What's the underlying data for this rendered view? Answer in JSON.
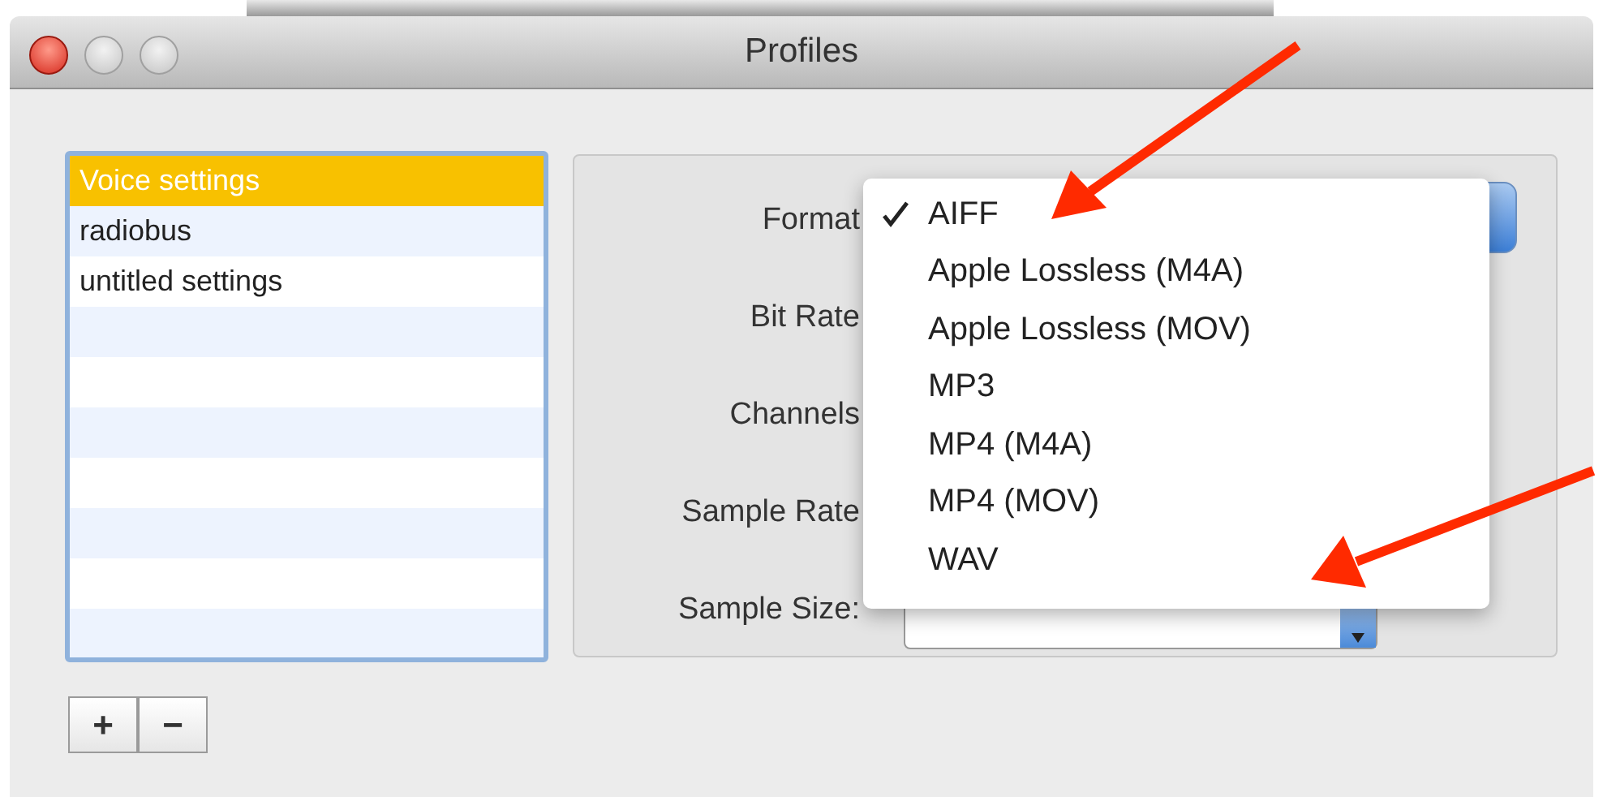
{
  "window": {
    "title": "Profiles"
  },
  "profiles": [
    {
      "name": "Voice settings",
      "selected": true
    },
    {
      "name": "radiobus",
      "selected": false
    },
    {
      "name": "untitled settings",
      "selected": false
    }
  ],
  "list_buttons": [
    "+",
    "−"
  ],
  "fields": [
    {
      "label": "Format"
    },
    {
      "label": "Bit Rate"
    },
    {
      "label": "Channels"
    },
    {
      "label": "Sample Rate"
    },
    {
      "label": "Sample Size:"
    }
  ],
  "format_menu": {
    "items": [
      {
        "label": "AIFF",
        "checked": true
      },
      {
        "label": "Apple Lossless (M4A)",
        "checked": false
      },
      {
        "label": "Apple Lossless (MOV)",
        "checked": false
      },
      {
        "label": "MP3",
        "checked": false
      },
      {
        "label": "MP4 (M4A)",
        "checked": false
      },
      {
        "label": "MP4 (MOV)",
        "checked": false
      },
      {
        "label": "WAV",
        "checked": false
      }
    ]
  }
}
